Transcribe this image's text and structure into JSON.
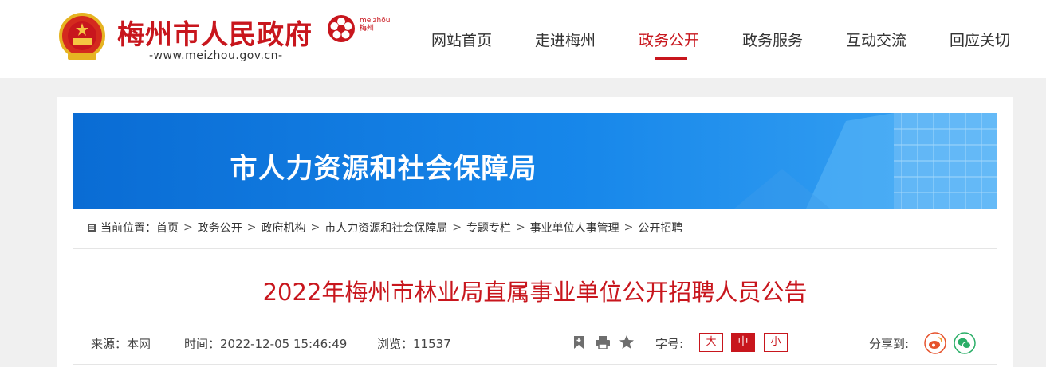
{
  "header": {
    "site_title": "梅州市人民政府",
    "site_url": "-www.meizhou.gov.cn-",
    "city_logo_text_top": "meizhōu",
    "city_logo_text_bottom": "梅州"
  },
  "nav": {
    "items": [
      {
        "label": "网站首页"
      },
      {
        "label": "走进梅州"
      },
      {
        "label": "政务公开"
      },
      {
        "label": "政务服务"
      },
      {
        "label": "互动交流"
      },
      {
        "label": "回应关切"
      }
    ],
    "active_index": 2
  },
  "banner": {
    "title": "市人力资源和社会保障局"
  },
  "breadcrumb": {
    "label": "当前位置：",
    "items": [
      "首页",
      "政务公开",
      "政府机构",
      "市人力资源和社会保障局",
      "专题专栏",
      "事业单位人事管理",
      "公开招聘"
    ],
    "separator": ">"
  },
  "article": {
    "title": "2022年梅州市林业局直属事业单位公开招聘人员公告",
    "source": "来源：本网",
    "time": "时间：2022-12-05 15:46:49",
    "views": "浏览：11537",
    "font_size_label": "字号:",
    "font_sizes": [
      "大",
      "中",
      "小"
    ],
    "share_label": "分享到:"
  },
  "icons": {
    "emblem": "national-emblem-icon",
    "city_logo": "meizhou-flower-logo-icon",
    "bookmark": "bookmark-icon",
    "print": "print-icon",
    "favorite": "star-icon",
    "weibo": "weibo-icon",
    "wechat": "wechat-icon"
  },
  "colors": {
    "brand_red": "#c8161d",
    "banner_blue": "#1787ea"
  }
}
